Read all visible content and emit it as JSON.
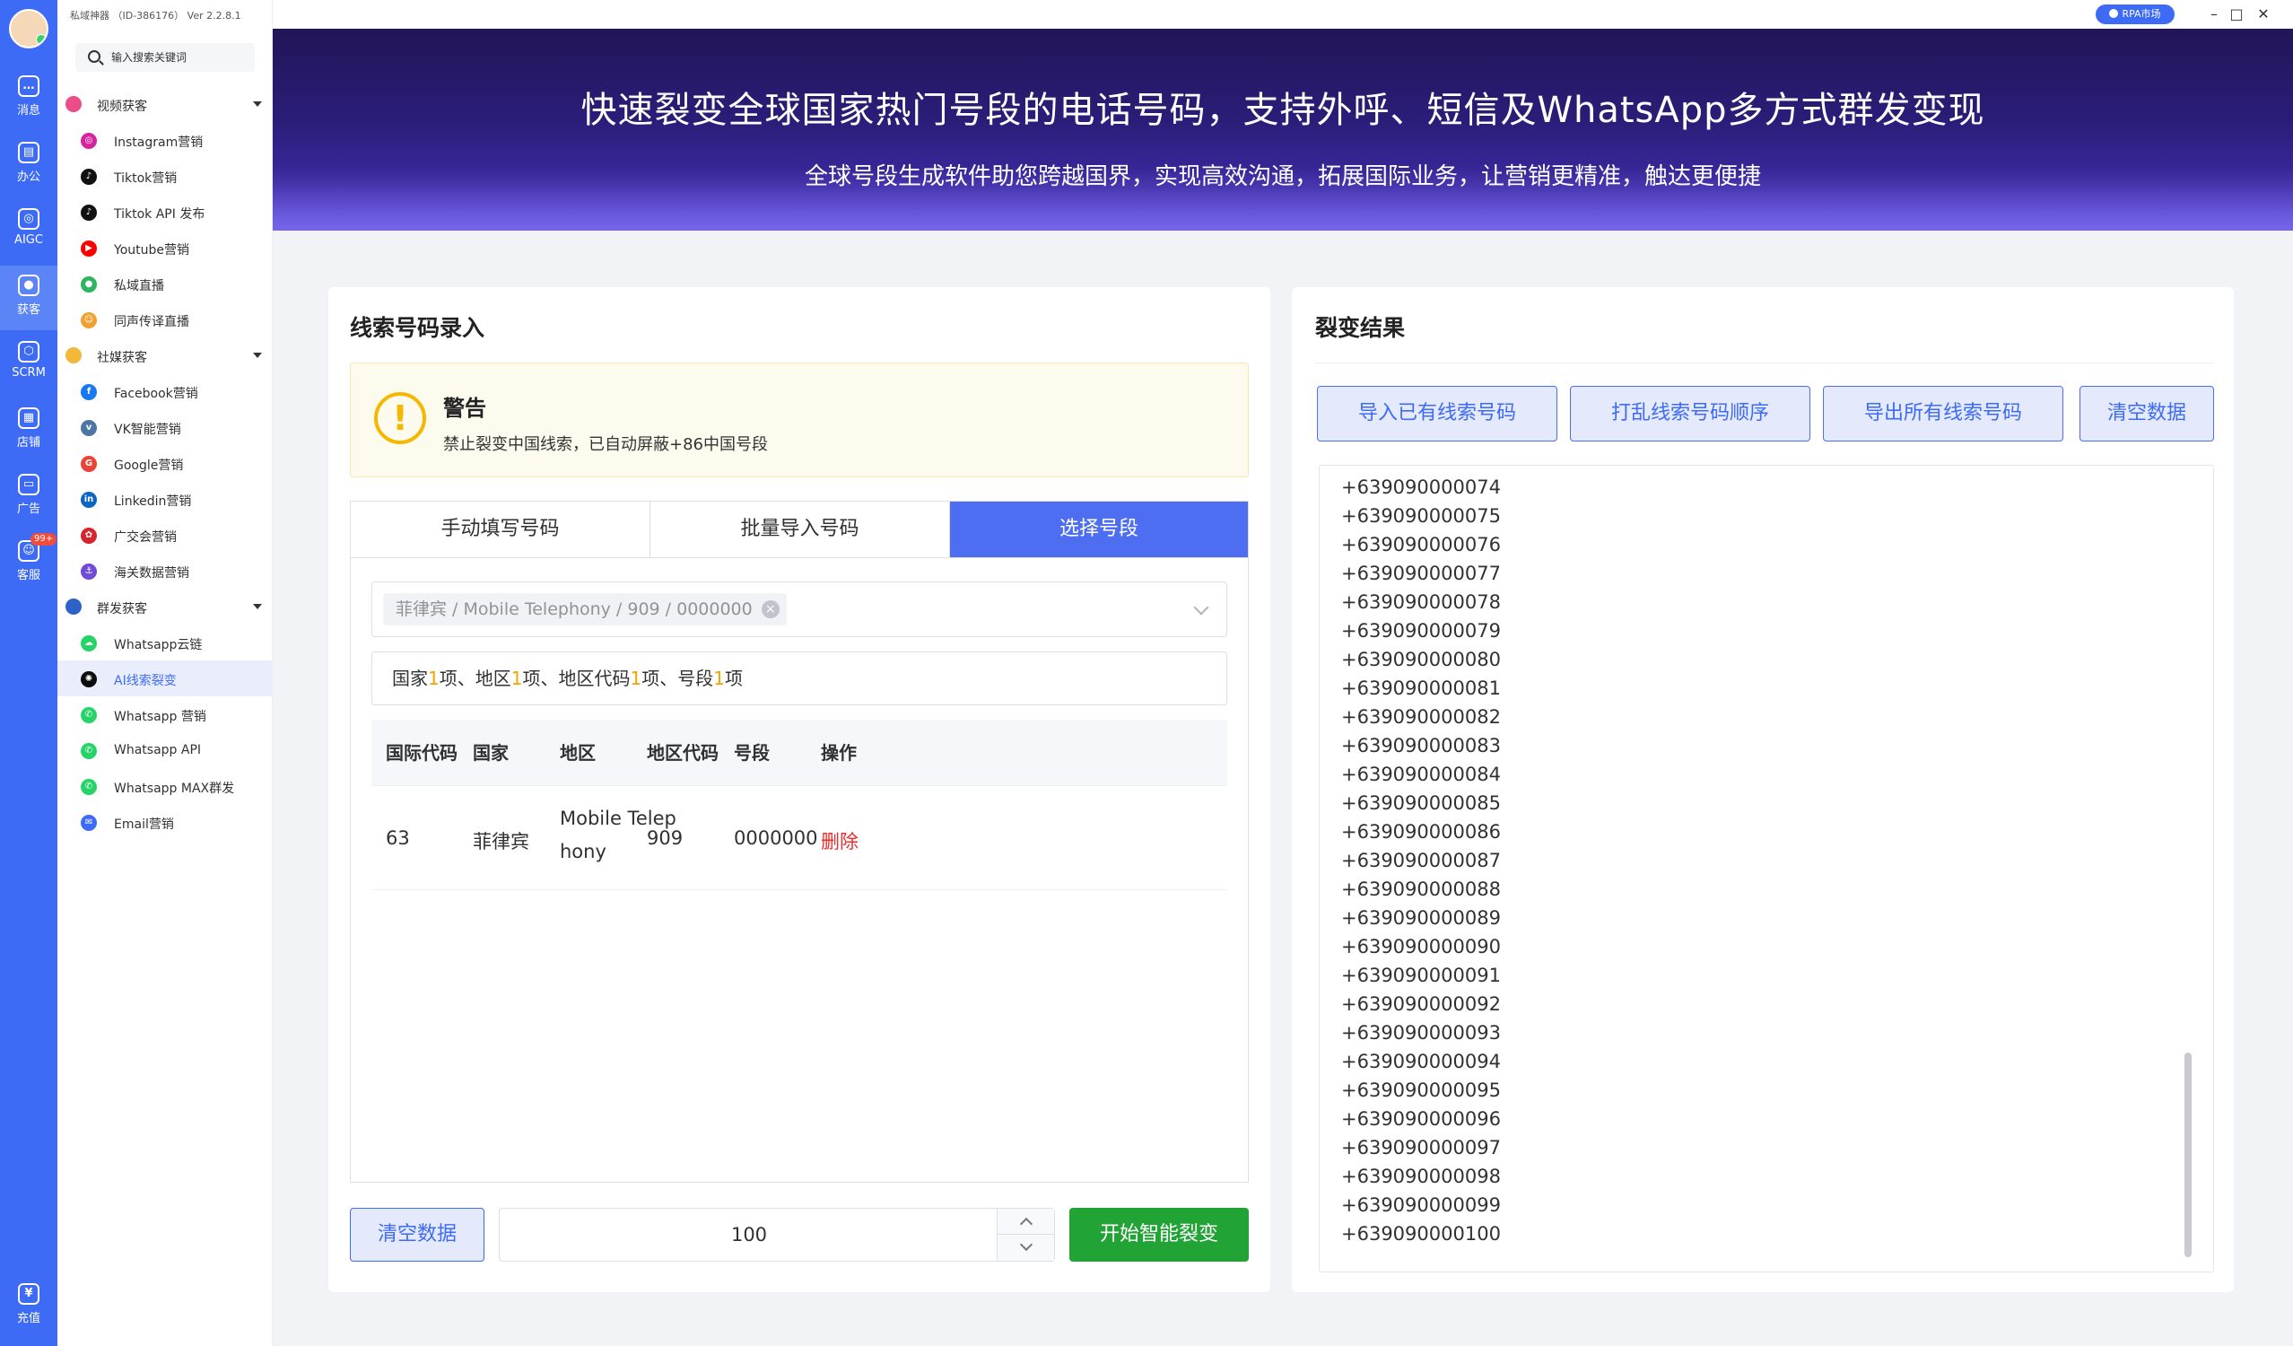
{
  "app": {
    "title": "私域神器 （ID-386176） Ver 2.2.8.1"
  },
  "topbar": {
    "rpa_label": "RPA市场",
    "min_icon": "minimize-icon",
    "max_icon": "maximize-icon",
    "close_icon": "close-icon"
  },
  "rail": {
    "items": [
      {
        "label": "消息",
        "icon": "message-icon"
      },
      {
        "label": "办公",
        "icon": "office-icon"
      },
      {
        "label": "AIGC",
        "icon": "aigc-icon"
      },
      {
        "label": "获客",
        "icon": "user-icon"
      },
      {
        "label": "SCRM",
        "icon": "scrm-icon"
      },
      {
        "label": "店铺",
        "icon": "shop-icon"
      },
      {
        "label": "广告",
        "icon": "ads-icon"
      },
      {
        "label": "客服",
        "icon": "service-icon",
        "badge": "99+"
      },
      {
        "label": "充值",
        "icon": "recharge-icon"
      }
    ]
  },
  "menu": {
    "search_placeholder": "输入搜索关键词",
    "groups": [
      {
        "label": "视频获客",
        "items": [
          "Instagram营销",
          "Tiktok营销",
          "Tiktok API 发布",
          "Youtube营销",
          "私域直播",
          "同声传译直播"
        ]
      },
      {
        "label": "社媒获客",
        "items": [
          "Facebook营销",
          "VK智能营销",
          "Google营销",
          "Linkedin营销",
          "广交会营销",
          "海关数据营销"
        ]
      },
      {
        "label": "群发获客",
        "items": [
          "Whatsapp云链",
          "AI线索裂变",
          "Whatsapp 营销",
          "Whatsapp API",
          "Whatsapp MAX群发",
          "Email营销"
        ]
      }
    ]
  },
  "banner": {
    "title": "快速裂变全球国家热门号段的电话号码，支持外呼、短信及WhatsApp多方式群发变现",
    "subtitle": "全球号段生成软件助您跨越国界，实现高效沟通，拓展国际业务，让营销更精准，触达更便捷"
  },
  "left_card": {
    "title": "线索号码录入",
    "warning": {
      "title": "警告",
      "text": "禁止裂变中国线索，已自动屏蔽+86中国号段"
    },
    "tabs": [
      "手动填写号码",
      "批量导入号码",
      "选择号段"
    ],
    "selected_chip": "菲律宾 / Mobile Telephony / 909 / 0000000",
    "summary": {
      "p1": "国家",
      "n1": "1",
      "p2": "项、地区",
      "n2": "1",
      "p3": "项、地区代码",
      "n3": "1",
      "p4": "项、号段",
      "n4": "1",
      "p5": "项"
    },
    "table": {
      "headers": [
        "国际代码",
        "国家",
        "地区",
        "地区代码",
        "号段",
        "操作"
      ],
      "rows": [
        {
          "code": "63",
          "country": "菲律宾",
          "region_l1": "Mobile Telep",
          "region_l2": "hony",
          "area": "909",
          "segment": "0000000",
          "action": "删除"
        }
      ]
    },
    "clear_button": "清空数据",
    "count_value": "100",
    "start_button": "开始智能裂变"
  },
  "right_card": {
    "title": "裂变结果",
    "buttons": [
      "导入已有线索号码",
      "打乱线索号码顺序",
      "导出所有线索号码",
      "清空数据"
    ],
    "results": [
      "+639090000074",
      "+639090000075",
      "+639090000076",
      "+639090000077",
      "+639090000078",
      "+639090000079",
      "+639090000080",
      "+639090000081",
      "+639090000082",
      "+639090000083",
      "+639090000084",
      "+639090000085",
      "+639090000086",
      "+639090000087",
      "+639090000088",
      "+639090000089",
      "+639090000090",
      "+639090000091",
      "+639090000092",
      "+639090000093",
      "+639090000094",
      "+639090000095",
      "+639090000096",
      "+639090000097",
      "+639090000098",
      "+639090000099",
      "+639090000100"
    ]
  }
}
